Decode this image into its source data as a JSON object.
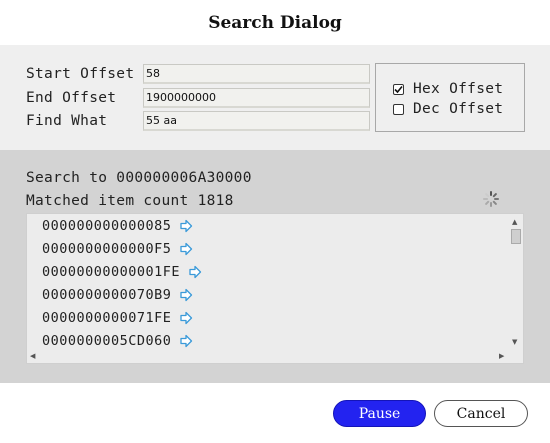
{
  "dialog": {
    "title": "Search Dialog"
  },
  "fields": {
    "start_offset": {
      "label": "Start Offset",
      "value": "58"
    },
    "end_offset": {
      "label": "End Offset",
      "value": "1900000000"
    },
    "find_what": {
      "label": "Find What",
      "value": "55 aa"
    }
  },
  "options": {
    "hex_offset": {
      "label": "Hex Offset",
      "checked": true
    },
    "dec_offset": {
      "label": "Dec Offset",
      "checked": false
    }
  },
  "status": {
    "search_to": "Search to 000000006A30000",
    "matched_count": "Matched item count 1818"
  },
  "results": [
    "000000000000085",
    "0000000000000F5",
    "00000000000001FE",
    "0000000000070B9",
    "0000000000071FE",
    "0000000005CD060"
  ],
  "buttons": {
    "primary": "Pause",
    "secondary": "Cancel"
  },
  "icons": {
    "row_action": "arrow-right-icon",
    "spinner": "loading-spinner-icon",
    "checkbox_checked": "checkmark-icon"
  },
  "colors": {
    "accent": "#2323f0",
    "row_arrow": "#3a9ad9",
    "panel_bg": "#d3d3d3"
  }
}
